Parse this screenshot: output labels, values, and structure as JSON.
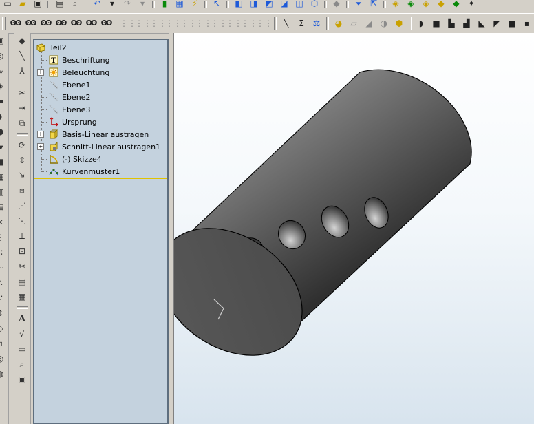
{
  "feature_tree": {
    "root": "Teil2",
    "items": [
      {
        "label": "Beschriftung",
        "icon": "annotation-icon",
        "expandable": false
      },
      {
        "label": "Beleuchtung",
        "icon": "lighting-icon",
        "expandable": true
      },
      {
        "label": "Ebene1",
        "icon": "plane-icon",
        "expandable": false
      },
      {
        "label": "Ebene2",
        "icon": "plane-icon",
        "expandable": false
      },
      {
        "label": "Ebene3",
        "icon": "plane-icon",
        "expandable": false
      },
      {
        "label": "Ursprung",
        "icon": "origin-icon",
        "expandable": false
      },
      {
        "label": "Basis-Linear austragen",
        "icon": "extrude-icon",
        "expandable": true
      },
      {
        "label": "Schnitt-Linear austragen1",
        "icon": "cut-extrude-icon",
        "expandable": true
      },
      {
        "label": "(-) Skizze4",
        "icon": "sketch-icon",
        "expandable": false
      },
      {
        "label": "Kurvenmuster1",
        "icon": "curve-pattern-icon",
        "expandable": false
      }
    ]
  },
  "toolbar_left_panel": {
    "text_tool_label": "A"
  },
  "colors": {
    "tree_background": "#c4d2de",
    "selection_line": "#e0c200",
    "model_gray": "#6e6e6e"
  }
}
